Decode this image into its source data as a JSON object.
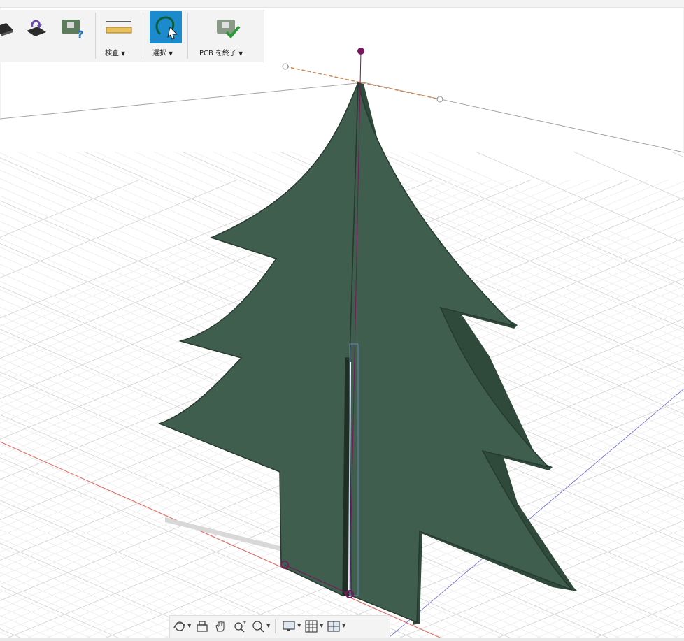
{
  "toolbar": {
    "inspect_label": "検査",
    "select_label": "選択",
    "finish_pcb_label": "PCB を終了"
  },
  "icons": {
    "chip_left": "chip-icon",
    "chip_redo": "chip-redo-icon",
    "board_help": "board-help-icon",
    "measure": "ruler-icon",
    "select": "lasso-select-icon",
    "finish": "board-check-icon"
  },
  "navigation": {
    "tools": [
      "orbit-icon",
      "look-at-icon",
      "pan-icon",
      "zoom-icon",
      "fit-icon",
      "display-settings-icon",
      "grid-icon",
      "viewports-icon"
    ]
  },
  "colors": {
    "tree_face": "#3f5e4e",
    "tree_edge": "#2a3f33",
    "select_active": "#1c8bcd",
    "x_axis": "#e0615a",
    "z_axis": "#6a6adf",
    "handle": "#7a1660"
  }
}
